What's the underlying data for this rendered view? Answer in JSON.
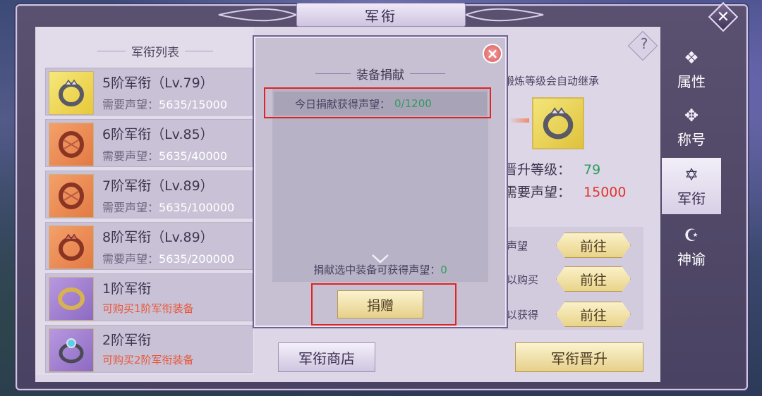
{
  "window": {
    "title": "军衔"
  },
  "list": {
    "header": "军衔列表",
    "items": [
      {
        "name": "5阶军衔（Lv.79）",
        "req_label": "需要声望：",
        "req_current": "5635",
        "req_total": "/15000",
        "color": "gold"
      },
      {
        "name": "6阶军衔（Lv.85）",
        "req_label": "需要声望：",
        "req_current": "5635",
        "req_total": "/40000",
        "color": "orange"
      },
      {
        "name": "7阶军衔（Lv.89）",
        "req_label": "需要声望：",
        "req_current": "5635",
        "req_total": "/100000",
        "color": "orange"
      },
      {
        "name": "8阶军衔（Lv.89）",
        "req_label": "需要声望：",
        "req_current": "5635",
        "req_total": "/200000",
        "color": "orange"
      },
      {
        "name": "1阶军衔",
        "buy_text": "可购买1阶军衔装备",
        "color": "purple"
      },
      {
        "name": "2阶军衔",
        "buy_text": "可购买2阶军衔装备",
        "color": "purple"
      }
    ]
  },
  "detail": {
    "top_text": "锻炼等级会自动继承",
    "help": "?",
    "upgrade_level_label": "晋升等级：",
    "upgrade_level_value": "79",
    "required_rep_label": "需要声望：",
    "required_rep_value": "15000",
    "routes": [
      {
        "label": "声望",
        "button": "前往"
      },
      {
        "label": "以购买",
        "button": "前往"
      },
      {
        "label": "以获得",
        "button": "前往"
      }
    ]
  },
  "buttons": {
    "shop": "军衔商店",
    "upgrade": "军衔晋升"
  },
  "tabs": [
    {
      "label": "属性",
      "icon": "wolf-crest-icon",
      "glyph": "❖"
    },
    {
      "label": "称号",
      "icon": "sword-emblem-icon",
      "glyph": "✥"
    },
    {
      "label": "军衔",
      "icon": "star-badge-icon",
      "glyph": "✡"
    },
    {
      "label": "神谕",
      "icon": "crescent-orb-icon",
      "glyph": "☪"
    }
  ],
  "active_tab": "军衔",
  "popup": {
    "title": "装备捐献",
    "today_label": "今日捐献获得声望：",
    "today_value": "0/1200",
    "hint_label": "捐献选中装备可获得声望：",
    "hint_value": "0",
    "donate_button": "捐赠",
    "close": "×"
  },
  "colors": {
    "green_value": "#2f9c5c",
    "red_value": "#e2342a",
    "highlight_box": "#e02424",
    "buy_text": "#e8573a"
  }
}
